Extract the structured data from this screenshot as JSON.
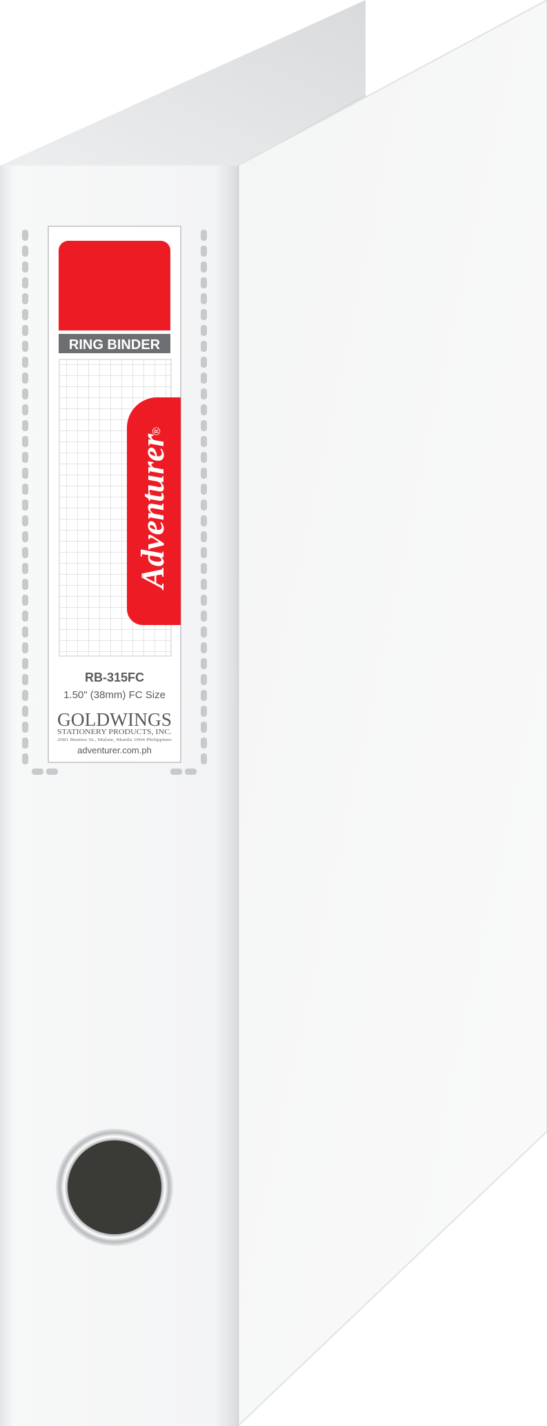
{
  "product": {
    "category_label": "RING BINDER",
    "brand": "Adventurer",
    "registered_mark": "®",
    "model": "RB-315FC",
    "size": "1.50\" (38mm) FC Size",
    "company_name": "GOLDWINGS",
    "company_subtitle": "STATIONERY PRODUCTS, INC.",
    "company_address": "2081 Benitez St., Malate, Manila 1004 Philippines",
    "website": "adventurer.com.ph"
  },
  "colors": {
    "binder_body": "#f4f5f5",
    "spine": "#f2f3f4",
    "inner_board": "#dcdddf",
    "label_header_red": "#ed1c24",
    "label_band_gray": "#6d6e71",
    "brand_tab_red": "#ed1c24",
    "finger_ring_dark": "#3a3b37",
    "finger_ring_chrome": "#c9cbcf"
  }
}
